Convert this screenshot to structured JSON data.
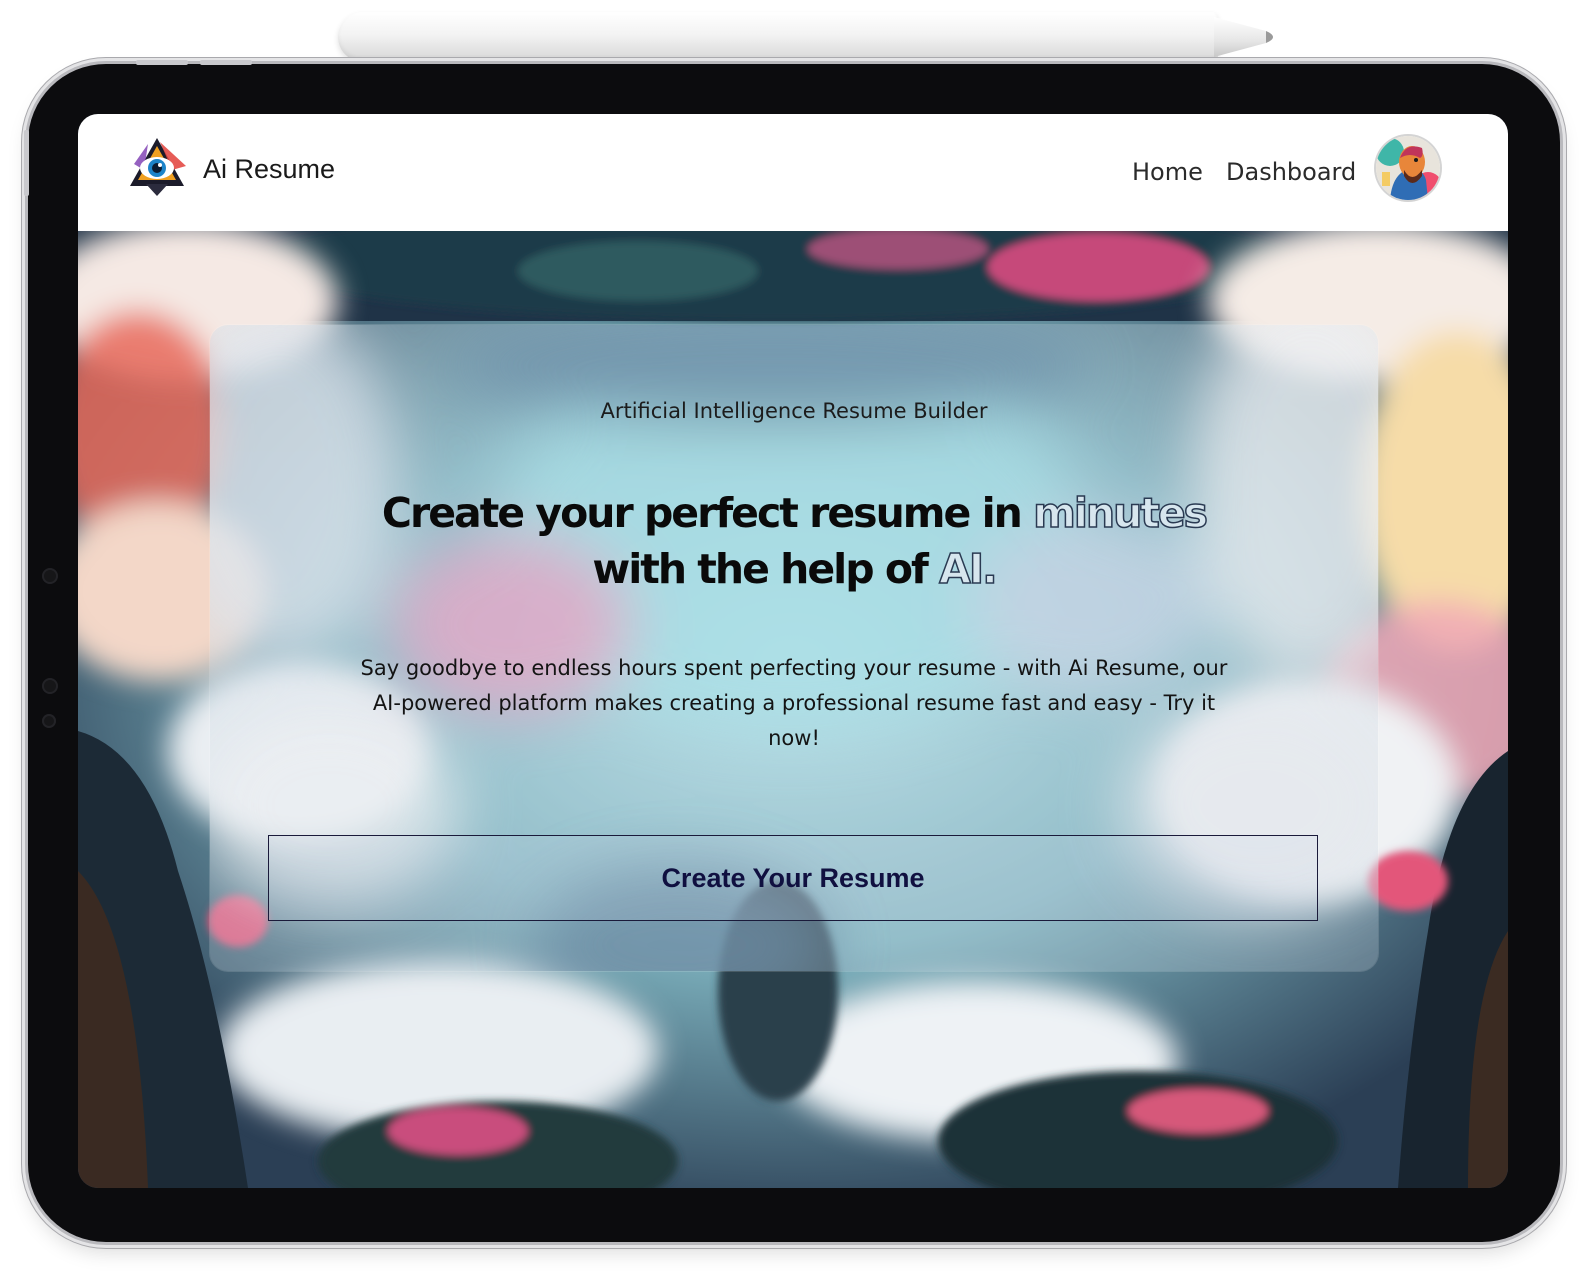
{
  "navbar": {
    "brand": "Ai Resume",
    "links": [
      {
        "label": "Home"
      },
      {
        "label": "Dashboard"
      }
    ]
  },
  "hero": {
    "eyebrow": "Artificial Intelligence Resume Builder",
    "headline": {
      "part1": "Create your perfect resume in ",
      "highlight1": "minutes",
      "part2": " with the help of ",
      "highlight2": "AI.",
      "part3": ""
    },
    "description": "Say goodbye to endless hours spent perfecting your resume - with Ai Resume, our AI-powered platform makes creating a professional resume fast and easy - Try it now!",
    "cta_label": "Create Your Resume"
  },
  "colors": {
    "cta_text": "#101040",
    "highlight_fill": "#d7e6ee",
    "highlight_stroke": "#2a3a52"
  },
  "icons": {
    "logo": "eye-logo-icon",
    "avatar": "user-avatar"
  }
}
